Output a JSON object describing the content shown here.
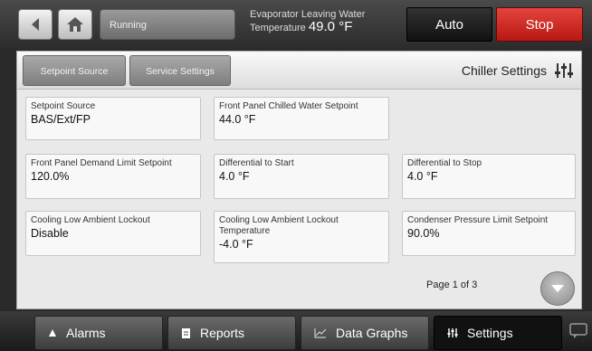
{
  "header": {
    "status": "Running",
    "evap_label_line1": "Evaporator Leaving Water",
    "evap_label_line2": "Temperature",
    "evap_temp": "49.0 °F",
    "auto_label": "Auto",
    "stop_label": "Stop"
  },
  "tabs": [
    {
      "label": "Setpoint Source"
    },
    {
      "label": "Service Settings"
    }
  ],
  "section_title": "Chiller Settings",
  "settings": [
    {
      "label": "Setpoint Source",
      "value": "BAS/Ext/FP"
    },
    {
      "label": "Front Panel Chilled Water Setpoint",
      "value": "44.0 °F"
    },
    {
      "label": "Front Panel Demand Limit Setpoint",
      "value": "120.0%"
    },
    {
      "label": "Differential to Start",
      "value": "4.0 °F"
    },
    {
      "label": "Differential to Stop",
      "value": "4.0 °F"
    },
    {
      "label": "Cooling Low Ambient Lockout",
      "value": "Disable"
    },
    {
      "label": "Cooling Low Ambient Lockout Temperature",
      "value": "-4.0 °F"
    },
    {
      "label": "Condenser Pressure Limit Setpoint",
      "value": "90.0%"
    }
  ],
  "pagination": {
    "text": "Page 1 of 3"
  },
  "nav": [
    {
      "label": "Alarms",
      "icon": "bell-icon"
    },
    {
      "label": "Reports",
      "icon": "document-icon"
    },
    {
      "label": "Data Graphs",
      "icon": "line-chart-icon"
    },
    {
      "label": "Settings",
      "icon": "sliders-icon"
    }
  ],
  "colors": {
    "stop": "#d42a24",
    "active_nav": "#111111"
  }
}
